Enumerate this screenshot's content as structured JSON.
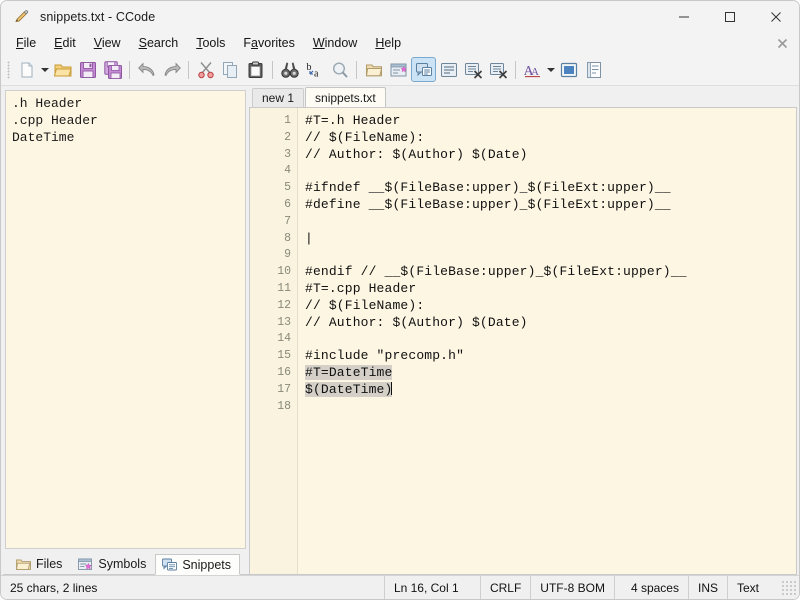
{
  "window": {
    "title": "snippets.txt - CCode",
    "icon": "pencil-icon",
    "controls": {
      "minimize": "—",
      "maximize": "☐",
      "close": "✕"
    }
  },
  "menubar": {
    "items": [
      {
        "label": "File",
        "accel": "F"
      },
      {
        "label": "Edit",
        "accel": "E"
      },
      {
        "label": "View",
        "accel": "V"
      },
      {
        "label": "Search",
        "accel": "S"
      },
      {
        "label": "Tools",
        "accel": "T"
      },
      {
        "label": "Favorites",
        "accel": "a"
      },
      {
        "label": "Window",
        "accel": "W"
      },
      {
        "label": "Help",
        "accel": "H"
      }
    ],
    "close_doc": "✕"
  },
  "toolbar": {
    "buttons": [
      {
        "name": "new-file-icon",
        "title": "New"
      },
      {
        "name": "new-file-dropdown-icon",
        "title": "New dropdown"
      },
      {
        "name": "open-folder-icon",
        "title": "Open"
      },
      {
        "name": "save-icon",
        "title": "Save"
      },
      {
        "name": "save-all-icon",
        "title": "Save All"
      },
      {
        "name": "undo-icon",
        "title": "Undo"
      },
      {
        "name": "redo-icon",
        "title": "Redo"
      },
      {
        "name": "cut-icon",
        "title": "Cut"
      },
      {
        "name": "copy-icon",
        "title": "Copy"
      },
      {
        "name": "paste-icon",
        "title": "Paste"
      },
      {
        "name": "find-icon",
        "title": "Find"
      },
      {
        "name": "replace-icon",
        "title": "Replace"
      },
      {
        "name": "find-in-files-icon",
        "title": "Find in Files"
      },
      {
        "name": "files-panel-icon",
        "title": "Files Panel"
      },
      {
        "name": "symbols-panel-icon",
        "title": "Symbols Panel"
      },
      {
        "name": "snippets-panel-icon",
        "title": "Snippets Panel"
      },
      {
        "name": "output-panel-icon",
        "title": "Output Panel"
      },
      {
        "name": "build-icon",
        "title": "Build"
      },
      {
        "name": "build-run-icon",
        "title": "Build and Run"
      },
      {
        "name": "font-icon",
        "title": "Font"
      },
      {
        "name": "font-dropdown-icon",
        "title": "Font dropdown"
      },
      {
        "name": "fullscreen-icon",
        "title": "Full Screen"
      },
      {
        "name": "properties-icon",
        "title": "Properties"
      }
    ]
  },
  "left_panel": {
    "snippets": [
      {
        "label": ".h Header"
      },
      {
        "label": ".cpp Header"
      },
      {
        "label": "DateTime"
      }
    ],
    "tabs": [
      {
        "label": "Files",
        "icon": "folder-icon",
        "active": false
      },
      {
        "label": "Symbols",
        "icon": "symbols-icon",
        "active": false
      },
      {
        "label": "Snippets",
        "icon": "snippets-icon",
        "active": true
      }
    ]
  },
  "editor": {
    "tabs": [
      {
        "label": "new 1",
        "active": false
      },
      {
        "label": "snippets.txt",
        "active": true
      }
    ],
    "line_numbers": [
      "1",
      "2",
      "3",
      "4",
      "5",
      "6",
      "7",
      "8",
      "9",
      "10",
      "11",
      "12",
      "13",
      "14",
      "15",
      "16",
      "17",
      "18"
    ],
    "lines": [
      {
        "n": 1,
        "text": "#T=.h Header",
        "selected": false
      },
      {
        "n": 2,
        "text": "// $(FileName):",
        "selected": false
      },
      {
        "n": 3,
        "text": "// Author: $(Author) $(Date)",
        "selected": false
      },
      {
        "n": 4,
        "text": "",
        "selected": false
      },
      {
        "n": 5,
        "text": "#ifndef __$(FileBase:upper)_$(FileExt:upper)__",
        "selected": false
      },
      {
        "n": 6,
        "text": "#define __$(FileBase:upper)_$(FileExt:upper)__",
        "selected": false
      },
      {
        "n": 7,
        "text": "",
        "selected": false
      },
      {
        "n": 8,
        "text": "|",
        "selected": false
      },
      {
        "n": 9,
        "text": "",
        "selected": false
      },
      {
        "n": 10,
        "text": "#endif // __$(FileBase:upper)_$(FileExt:upper)__",
        "selected": false
      },
      {
        "n": 11,
        "text": "#T=.cpp Header",
        "selected": false
      },
      {
        "n": 12,
        "text": "// $(FileName):",
        "selected": false
      },
      {
        "n": 13,
        "text": "// Author: $(Author) $(Date)",
        "selected": false
      },
      {
        "n": 14,
        "text": "",
        "selected": false
      },
      {
        "n": 15,
        "text": "#include \"precomp.h\"",
        "selected": false
      },
      {
        "n": 16,
        "text": "#T=DateTime",
        "selected": true
      },
      {
        "n": 17,
        "text": "$(DateTime)",
        "selected": true,
        "caret_after": true
      },
      {
        "n": 18,
        "text": "",
        "selected": false
      }
    ]
  },
  "statusbar": {
    "doc_info": "25 chars, 2 lines",
    "position": "Ln 16, Col 1",
    "line_ending": "CRLF",
    "encoding": "UTF-8 BOM",
    "indent": "4 spaces",
    "insert_mode": "INS",
    "language": "Text"
  },
  "colors": {
    "editor_bg": "#fdf6e3",
    "gutter_bg": "#faf3e0",
    "chrome_bg": "#f0f0f0",
    "selection": "#d4d0c8",
    "accent": "#cce3f5"
  }
}
